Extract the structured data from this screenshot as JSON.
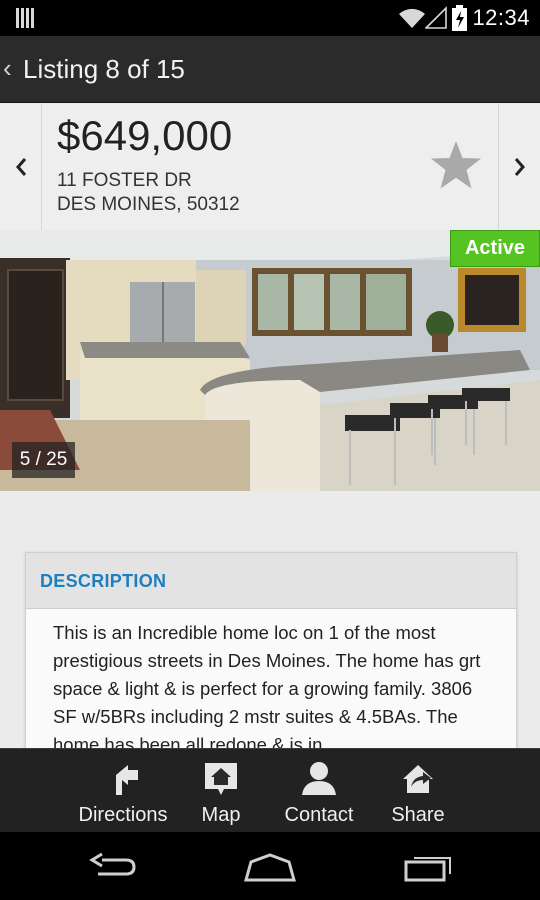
{
  "status_bar": {
    "time": "12:34",
    "icons": [
      "notification-icon",
      "wifi-icon",
      "signal-icon",
      "battery-icon"
    ]
  },
  "action_bar": {
    "back_icon": "chevron-left-icon",
    "title": "Listing 8 of 15"
  },
  "listing": {
    "price": "$649,000",
    "address_line1": "11 FOSTER DR",
    "address_line2": "DES MOINES, 50312",
    "favorite_icon": "star-icon"
  },
  "photo": {
    "status_badge": "Active",
    "counter": "5 / 25",
    "badge_color": "#55c322"
  },
  "description": {
    "title": "DESCRIPTION",
    "text": "This is an Incredible home loc on 1 of the most prestigious streets in Des Moines. The home has grt space & light & is perfect for a growing family. 3806 SF w/5BRs including 2 mstr suites & 4.5BAs. The home has been all redone & is in"
  },
  "toolbar": {
    "items": [
      {
        "label": "Directions",
        "icon": "directions-icon"
      },
      {
        "label": "Map",
        "icon": "map-icon"
      },
      {
        "label": "Contact",
        "icon": "contact-icon"
      },
      {
        "label": "Share",
        "icon": "share-icon"
      }
    ]
  },
  "navbar": {
    "icons": [
      "back-icon",
      "home-icon",
      "recent-apps-icon"
    ]
  },
  "colors": {
    "accent_blue": "#1e7fbf",
    "action_bar": "#2b2b2b",
    "toolbar": "#222222"
  }
}
